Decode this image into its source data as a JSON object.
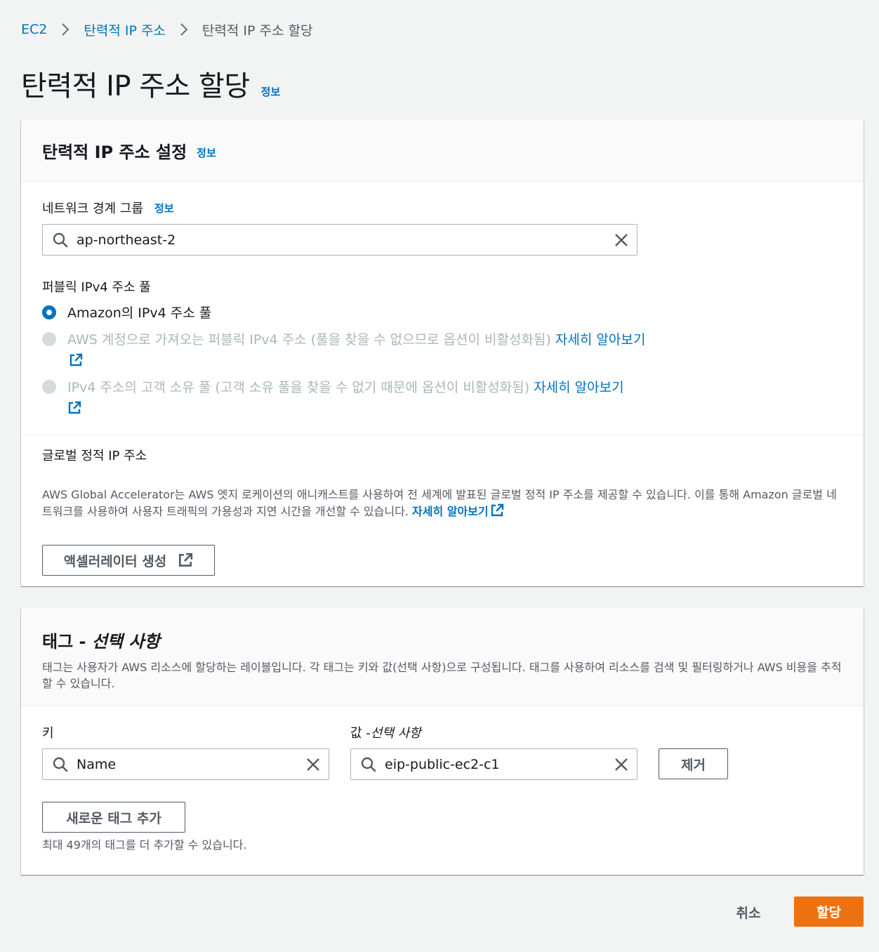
{
  "breadcrumb": {
    "items": [
      "EC2",
      "탄력적 IP 주소"
    ],
    "current": "탄력적 IP 주소 할당"
  },
  "page": {
    "title": "탄력적 IP 주소 할당",
    "info": "정보"
  },
  "settings": {
    "title": "탄력적 IP 주소 설정",
    "info": "정보",
    "network_border_group": {
      "label": "네트워크 경계 그룹",
      "info": "정보",
      "value": "ap-northeast-2"
    },
    "ipv4_pool": {
      "label": "퍼블릭 IPv4 주소 풀",
      "options": [
        {
          "label": "Amazon의 IPv4 주소 풀",
          "selected": true,
          "disabled": false
        },
        {
          "label": "AWS 계정으로 가져오는 퍼블릭 IPv4 주소 (풀을 찾을 수 없으므로 옵션이 비활성화됨)",
          "link": "자세히 알아보기",
          "selected": false,
          "disabled": true
        },
        {
          "label": "IPv4 주소의 고객 소유 풀 (고객 소유 풀을 찾을 수 없기 때문에 옵션이 비활성화됨)",
          "link": "자세히 알아보기",
          "selected": false,
          "disabled": true
        }
      ]
    },
    "global_static_ip": {
      "label": "글로벌 정적 IP 주소",
      "description": "AWS Global Accelerator는 AWS 엣지 로케이션의 애니캐스트를 사용하여 전 세계에 발표된 글로벌 정적 IP 주소를 제공할 수 있습니다. 이를 통해 Amazon 글로벌 네트워크를 사용하여 사용자 트래픽의 가용성과 지연 시간을 개선할 수 있습니다.",
      "learn_more": "자세히 알아보기",
      "button": "액셀러레이터 생성"
    }
  },
  "tags": {
    "title_main": "태그 - ",
    "title_optional": "선택 사항",
    "description": "태그는 사용자가 AWS 리소스에 할당하는 레이블입니다. 각 태그는 키와 값(선택 사항)으로 구성됩니다. 태그를 사용하여 리소스를 검색 및 필터링하거나 AWS 비용을 추적할 수 있습니다.",
    "key_label": "키",
    "value_label_main": "값 - ",
    "value_label_optional": "선택 사항",
    "key_value": "Name",
    "value_value": "eip-public-ec2-c1",
    "remove_button": "제거",
    "add_button": "새로운 태그 추가",
    "limit_text": "최대 49개의 태그를 더 추가할 수 있습니다."
  },
  "footer": {
    "cancel": "취소",
    "submit": "할당"
  },
  "colors": {
    "link": "#0073bb",
    "primary": "#ec7211",
    "background": "#f2f3f3"
  },
  "icons": {
    "breadcrumb_separator": "chevron-right-icon",
    "search": "search-icon",
    "clear": "close-icon",
    "external": "external-link-icon"
  }
}
